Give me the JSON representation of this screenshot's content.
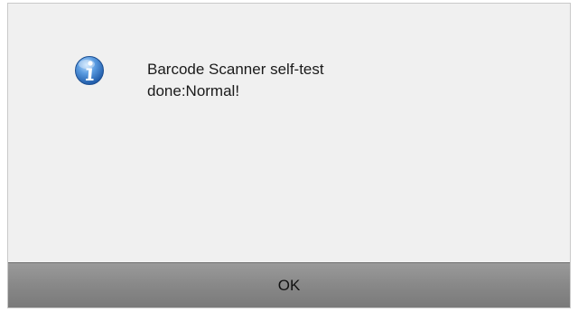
{
  "dialog": {
    "icon": "info-icon",
    "message_line1": "Barcode Scanner self-test",
    "message_line2": "done:Normal!",
    "ok_label": "OK"
  },
  "colors": {
    "dialog_bg": "#f0f0f0",
    "button_bar": "#888888",
    "icon_blue": "#3f7fc8"
  }
}
